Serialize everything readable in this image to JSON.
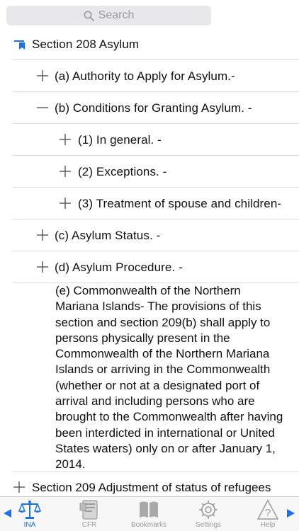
{
  "search": {
    "placeholder": "Search"
  },
  "tree": {
    "section_208": "Section 208 Asylum",
    "item_a": "(a) Authority to Apply for Asylum.-",
    "item_b": "(b) Conditions for Granting Asylum. -",
    "item_b1": "(1) In general. -",
    "item_b2": "(2) Exceptions. -",
    "item_b3": "(3) Treatment of spouse and children-",
    "item_c": "(c) Asylum Status. -",
    "item_d": "(d) Asylum Procedure. -",
    "item_e_text": "(e) Commonwealth of the Northern Mariana Islands- The provisions of this section and section 209(b) shall apply to persons physically present in the Commonwealth of the Northern Mariana Islands or arriving in the Commonwealth (whether or not at a designated port of arrival and including persons who are brought to the Commonwealth after having been interdicted in international or United States waters) only on or after January 1, 2014.",
    "section_209": "Section 209 Adjustment of status of refugees"
  },
  "tabs": [
    {
      "label": "INA",
      "icon": "scales-icon",
      "active": true
    },
    {
      "label": "CFR",
      "icon": "document-icon",
      "active": false
    },
    {
      "label": "Bookmarks",
      "icon": "book-icon",
      "active": false
    },
    {
      "label": "Settings",
      "icon": "gear-icon",
      "active": false
    },
    {
      "label": "Help",
      "icon": "help-icon",
      "active": false
    }
  ],
  "colors": {
    "accent": "#1a73e8",
    "inactive": "#9b9b9b",
    "bookmark": "#1a73e8"
  }
}
